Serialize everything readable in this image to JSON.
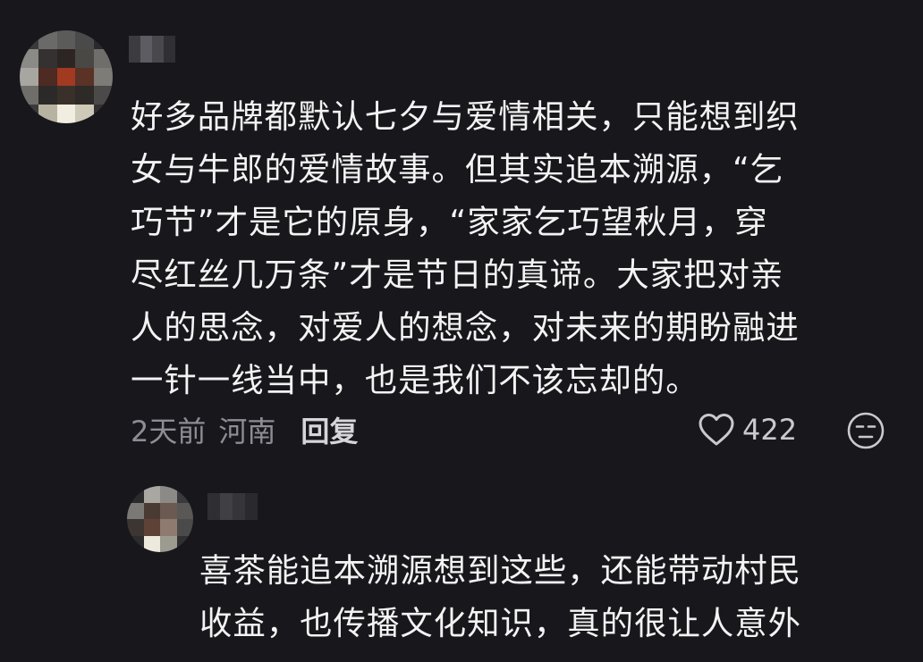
{
  "comments": [
    {
      "text_lines": [
        "好多品牌都默认七夕与爱情相关，只能想到织",
        "女与牛郎的爱情故事。但其实追本溯源，“乞",
        "巧节”才是它的原身，“家家乞巧望秋月，穿",
        "尽红丝几万条”才是节日的真谛。大家把对亲",
        "人的思念，对爱人的想念，对未来的期盼融进",
        "一针一线当中，也是我们不该忘却的。"
      ],
      "time": "2天前",
      "location": "河南",
      "reply_label": "回复",
      "like_count": "422"
    },
    {
      "text_lines": [
        "喜茶能追本溯源想到这些，还能带动村民",
        "收益，也传播文化知识，真的很让人意外"
      ]
    }
  ],
  "icons": {
    "like": "heart-outline-icon",
    "dislike": "unhappy-face-icon"
  },
  "colors": {
    "background": "#17171c",
    "text": "#f3f3f3",
    "meta": "#8d8d93"
  }
}
